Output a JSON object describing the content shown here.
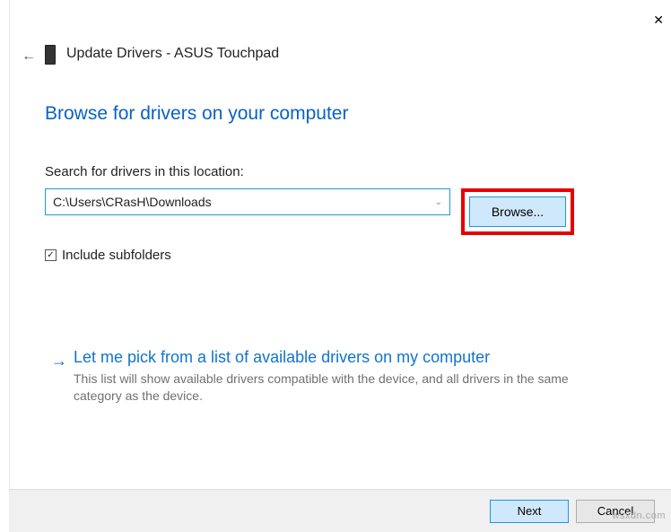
{
  "window": {
    "title": "Update Drivers - ASUS Touchpad",
    "close_glyph": "✕"
  },
  "nav": {
    "back_glyph": "←"
  },
  "heading": "Browse for drivers on your computer",
  "search_label": "Search for drivers in this location:",
  "path": "C:\\Users\\CRasH\\Downloads",
  "dropdown_glyph": "⌄",
  "browse_label": "Browse...",
  "include_subfolders": {
    "checked_glyph": "✓",
    "label": "Include subfolders"
  },
  "pick_option": {
    "arrow_glyph": "→",
    "title": "Let me pick from a list of available drivers on my computer",
    "description": "This list will show available drivers compatible with the device, and all drivers in the same category as the device."
  },
  "footer": {
    "next": "Next",
    "cancel": "Cancel"
  },
  "watermark": "wsxdn.com"
}
